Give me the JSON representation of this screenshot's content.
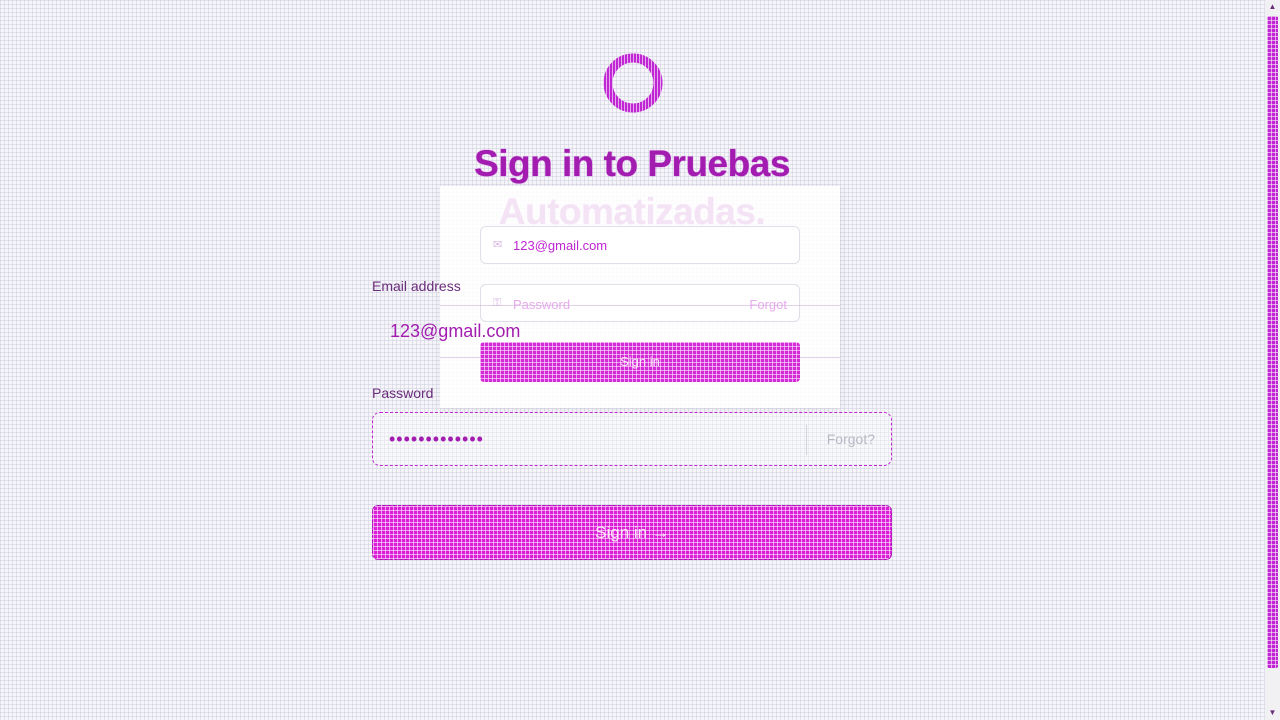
{
  "app": {
    "title": "Sign in to Pruebas Automatizadas."
  },
  "ghost_form": {
    "email_value": "123@gmail.com",
    "password_placeholder": "Password",
    "forgot_label": "Forgot",
    "button_label": "Sign in"
  },
  "form": {
    "email_label": "Email address",
    "email_value": "123@gmail.com",
    "password_label": "Password",
    "password_value": "•••••••••••••",
    "forgot_label": "Forgot?",
    "submit_label": "Sign in →"
  },
  "icons": {
    "logo": "ring-logo-icon",
    "email": "user-icon",
    "password": "lock-icon"
  },
  "colors": {
    "accent": "#c026d3",
    "button": "#db1fd8",
    "title": "#a21caf",
    "background": "#f6f6fa"
  }
}
